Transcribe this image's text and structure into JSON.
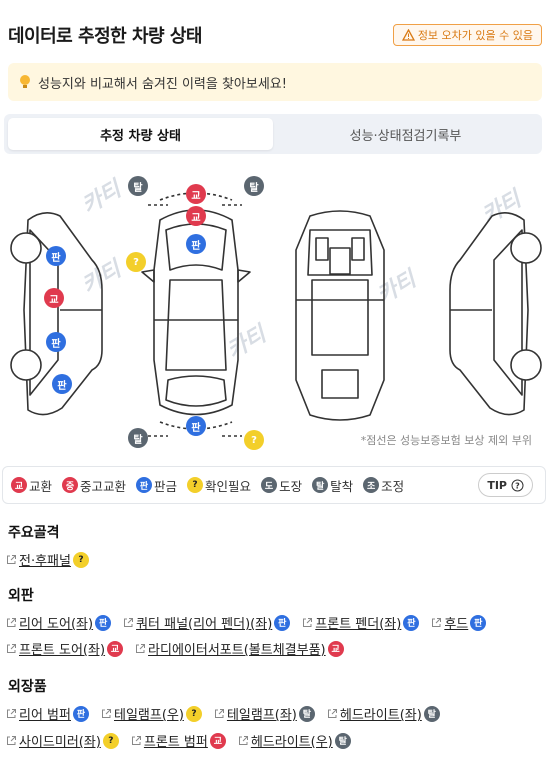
{
  "header": {
    "title": "데이터로 추정한 차량 상태",
    "warning": "정보 오차가 있을 수 있음"
  },
  "hint": {
    "text": "성능지와 비교해서 숨겨진 이력을 찾아보세요!"
  },
  "tabs": [
    {
      "label": "추정 차량 상태"
    },
    {
      "label": "성능·상태점검기록부"
    }
  ],
  "diagram": {
    "watermark": "카티",
    "note": "*점선은 성능보증보험 보상 제외 부위",
    "pins": {
      "talchak": "탈",
      "gyohwan": "교",
      "pangeum": "판",
      "check": "?"
    }
  },
  "legend": {
    "items": [
      {
        "icon": "교",
        "label": "교환",
        "color": "red"
      },
      {
        "icon": "중",
        "label": "중고교환",
        "color": "red"
      },
      {
        "icon": "판",
        "label": "판금",
        "color": "blue"
      },
      {
        "icon": "?",
        "label": "확인필요",
        "color": "yellow"
      },
      {
        "icon": "도",
        "label": "도장",
        "color": "gray"
      },
      {
        "icon": "탈",
        "label": "탈착",
        "color": "gray"
      },
      {
        "icon": "조",
        "label": "조정",
        "color": "gray"
      }
    ],
    "tip": "TIP"
  },
  "sections": {
    "frame": {
      "title": "주요골격",
      "items": [
        {
          "label": "전·후패널",
          "badge": "?",
          "color": "yellow"
        }
      ]
    },
    "outer": {
      "title": "외판",
      "rows": [
        [
          {
            "label": "리어 도어(좌)",
            "badge": "판",
            "color": "blue"
          },
          {
            "label": "쿼터 패널(리어 펜더)(좌)",
            "badge": "판",
            "color": "blue"
          },
          {
            "label": "프론트 펜더(좌)",
            "badge": "판",
            "color": "blue"
          },
          {
            "label": "후드",
            "badge": "판",
            "color": "blue"
          }
        ],
        [
          {
            "label": "프론트 도어(좌)",
            "badge": "교",
            "color": "red"
          },
          {
            "label": "라디에이터서포트(볼트체결부품)",
            "badge": "교",
            "color": "red"
          }
        ]
      ]
    },
    "exterior": {
      "title": "외장품",
      "rows": [
        [
          {
            "label": "리어 범퍼",
            "badge": "판",
            "color": "blue"
          },
          {
            "label": "테일램프(우)",
            "badge": "?",
            "color": "yellow"
          },
          {
            "label": "테일램프(좌)",
            "badge": "탈",
            "color": "gray"
          },
          {
            "label": "헤드라이트(좌)",
            "badge": "탈",
            "color": "gray"
          }
        ],
        [
          {
            "label": "사이드미러(좌)",
            "badge": "?",
            "color": "yellow"
          },
          {
            "label": "프론트 범퍼",
            "badge": "교",
            "color": "red"
          },
          {
            "label": "헤드라이트(우)",
            "badge": "탈",
            "color": "gray"
          }
        ]
      ]
    }
  }
}
